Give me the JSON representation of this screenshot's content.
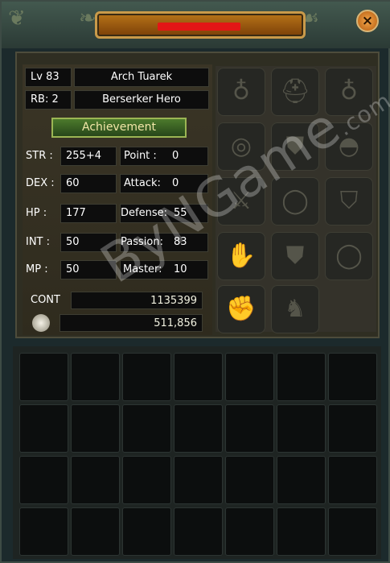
{
  "window": {
    "close_label": "×"
  },
  "character": {
    "level_label": "Lv 83",
    "name": "Arch Tuarek",
    "rb_label": "RB:  2",
    "class_title": "Berserker Hero",
    "achievement_button": "Achievement"
  },
  "stats_left": [
    {
      "label": "STR :",
      "value": "255+4"
    },
    {
      "label": "DEX :",
      "value": "60"
    },
    {
      "label": "HP :",
      "value": "177"
    },
    {
      "label": "INT :",
      "value": "50"
    },
    {
      "label": "MP :",
      "value": "50"
    }
  ],
  "stats_right": [
    {
      "label": "Point :",
      "value": "0"
    },
    {
      "label": "Attack:",
      "value": "0"
    },
    {
      "label": "Defense:",
      "value": "55"
    },
    {
      "label": "Passion:",
      "value": "83"
    },
    {
      "label": "Master:",
      "value": "10"
    }
  ],
  "cont": {
    "label": "CONT",
    "value": "1135399"
  },
  "gold": {
    "value": "511,856",
    "icon": "coin-pile-icon"
  },
  "equipment_slots": [
    "earring-icon",
    "helmet-icon",
    "earring-icon",
    "necklace-icon",
    "armor-icon",
    "pauldron-icon",
    "weapon-icon",
    "ring-icon",
    "shield-icon",
    "gloves-icon",
    "pants-icon",
    "ring-icon",
    "gauntlet-icon",
    "boots-icon"
  ],
  "watermark": {
    "text": "ByNGame",
    "suffix": ".com"
  },
  "colors": {
    "title_plate": "#b87418",
    "achievement": "#4c7a2c",
    "redacted": "#e31616"
  }
}
